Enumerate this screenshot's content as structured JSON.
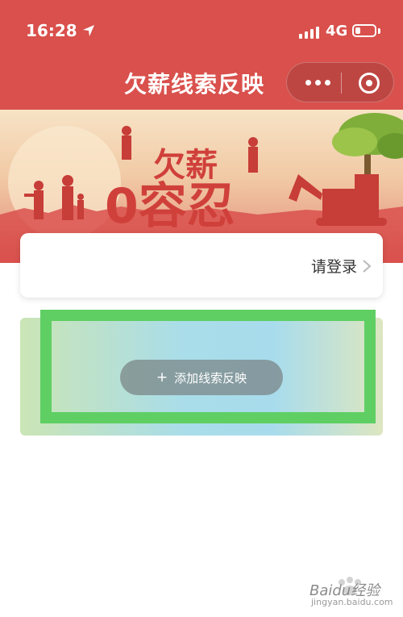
{
  "status_bar": {
    "time": "16:28",
    "network": "4G",
    "battery_level": 0.25
  },
  "nav": {
    "title": "欠薪线索反映"
  },
  "banner": {
    "headline_part1": "欠薪",
    "headline_part2": "0容忍"
  },
  "login": {
    "label": "请登录"
  },
  "add_clue": {
    "plus_icon": "+",
    "label": "添加线索反映"
  },
  "watermark": {
    "text": "Baidu经验",
    "sub": "jingyan.baidu.com"
  },
  "colors": {
    "brand_red": "#d9504c",
    "highlight_green": "#5fcf64"
  }
}
